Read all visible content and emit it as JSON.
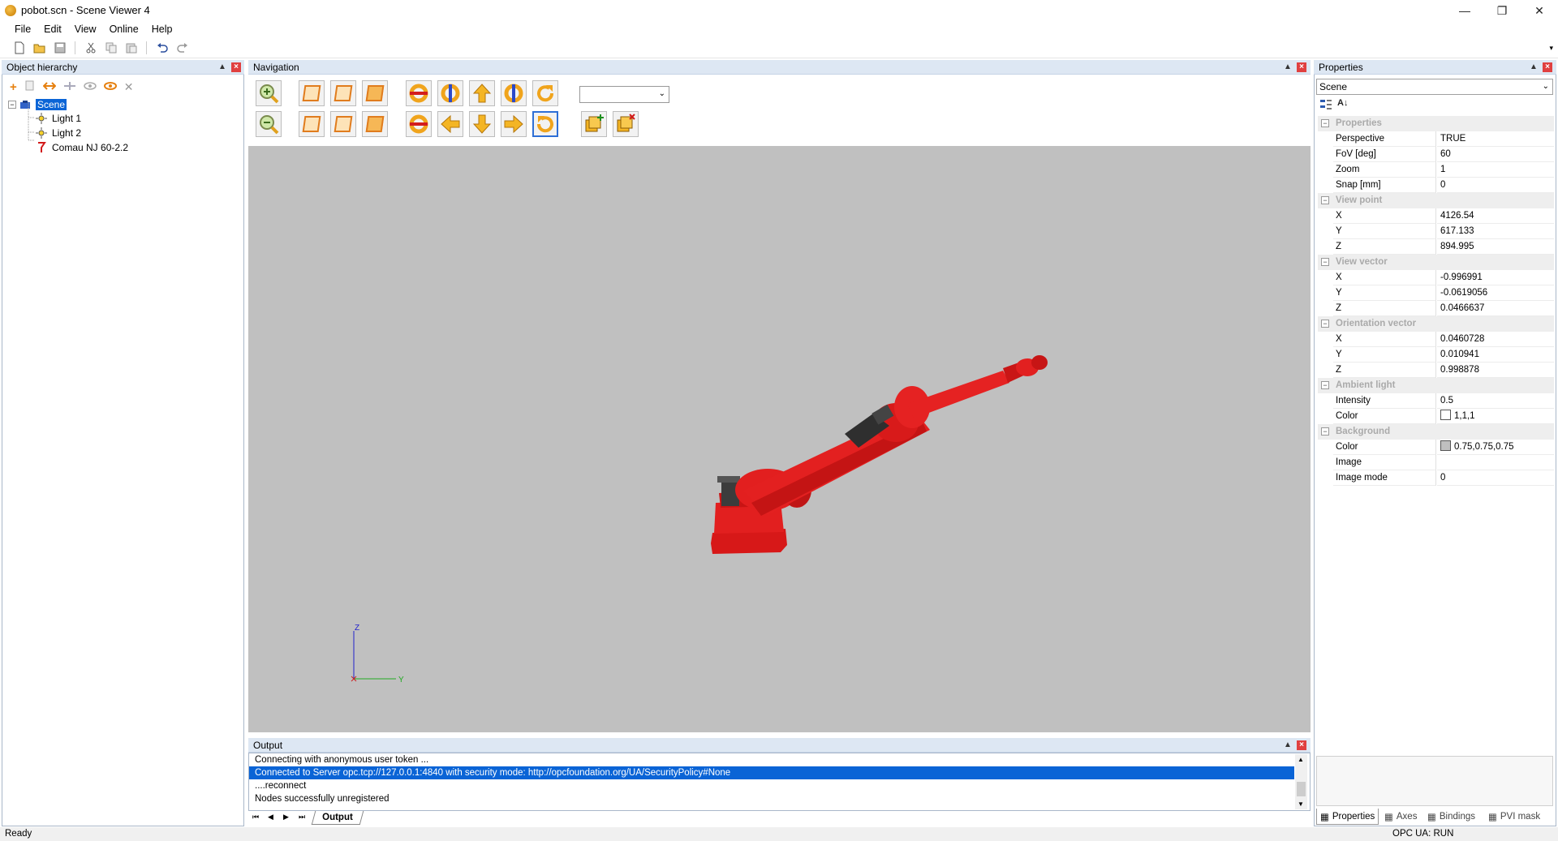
{
  "window": {
    "title": "pobot.scn - Scene Viewer 4"
  },
  "menu": [
    "File",
    "Edit",
    "View",
    "Online",
    "Help"
  ],
  "panels": {
    "hierarchy": {
      "title": "Object hierarchy"
    },
    "navigation": {
      "title": "Navigation"
    },
    "properties": {
      "title": "Properties"
    },
    "output": {
      "title": "Output"
    }
  },
  "hierarchy": {
    "root": "Scene",
    "children": [
      "Light 1",
      "Light 2",
      "Comau NJ 60-2.2"
    ]
  },
  "viewport": {
    "axes": {
      "z": "Z",
      "y": "Y"
    }
  },
  "output": {
    "lines": [
      "Connecting with anonymous user token ...",
      "Connected to Server opc.tcp://127.0.0.1:4840 with security mode: http://opcfoundation.org/UA/SecurityPolicy#None",
      "....reconnect",
      "Nodes successfully unregistered"
    ],
    "selected_index": 1,
    "tab": "Output"
  },
  "properties": {
    "object_select": "Scene",
    "categories": [
      {
        "name": "Properties",
        "rows": [
          {
            "key": "Perspective",
            "value": "TRUE"
          },
          {
            "key": "FoV [deg]",
            "value": "60"
          },
          {
            "key": "Zoom",
            "value": "1"
          },
          {
            "key": "Snap [mm]",
            "value": "0"
          }
        ]
      },
      {
        "name": "View point",
        "rows": [
          {
            "key": "X",
            "value": "4126.54"
          },
          {
            "key": "Y",
            "value": "617.133"
          },
          {
            "key": "Z",
            "value": "894.995"
          }
        ]
      },
      {
        "name": "View vector",
        "rows": [
          {
            "key": "X",
            "value": "-0.996991"
          },
          {
            "key": "Y",
            "value": "-0.0619056"
          },
          {
            "key": "Z",
            "value": "0.0466637"
          }
        ]
      },
      {
        "name": "Orientation vector",
        "rows": [
          {
            "key": "X",
            "value": "0.0460728"
          },
          {
            "key": "Y",
            "value": "0.010941"
          },
          {
            "key": "Z",
            "value": "0.998878"
          }
        ]
      },
      {
        "name": "Ambient light",
        "rows": [
          {
            "key": "Intensity",
            "value": "0.5"
          },
          {
            "key": "Color",
            "value": "1,1,1",
            "swatch": "#ffffff"
          }
        ]
      },
      {
        "name": "Background",
        "rows": [
          {
            "key": "Color",
            "value": "0.75,0.75,0.75",
            "swatch": "#bfbfbf"
          },
          {
            "key": "Image",
            "value": ""
          },
          {
            "key": "Image mode",
            "value": "0"
          }
        ]
      }
    ],
    "tabs": [
      "Properties",
      "Axes",
      "Bindings",
      "PVI mask"
    ]
  },
  "status": {
    "left": "Ready",
    "right": "OPC UA: RUN"
  },
  "colors": {
    "accent": "#0a64d6",
    "robot": "#e41b1b",
    "viewport_bg": "#c0c0c0",
    "panel_header": "#dde7f3"
  }
}
